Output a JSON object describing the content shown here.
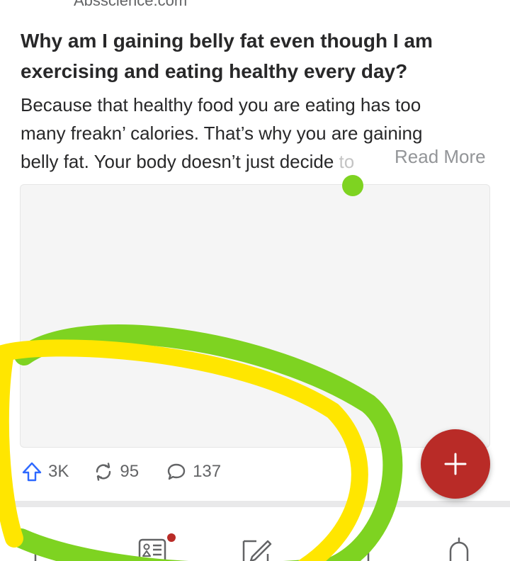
{
  "answer": {
    "source": "Absscience.com",
    "title": "Why am I gaining belly fat even though I am exercising and eating healthy every day?",
    "body_lines": [
      "Because that healthy food you are eating has too",
      "many freakn’ calories. That’s why you are gaining",
      "belly fat. Your body doesn’t just decide"
    ],
    "body_fade": "to",
    "read_more": "Read More"
  },
  "actions": {
    "upvotes": "3K",
    "shares": "95",
    "comments": "137"
  },
  "bottom_nav": {
    "items": [
      "home-icon",
      "answer-icon",
      "write-icon",
      "spaces-icon",
      "notifications-icon"
    ],
    "answer_badge": true
  },
  "colors": {
    "brand_red": "#b92b27",
    "upvote_blue": "#2e69ff",
    "highlight_green": "#7ed321",
    "highlight_yellow": "#ffe600"
  }
}
